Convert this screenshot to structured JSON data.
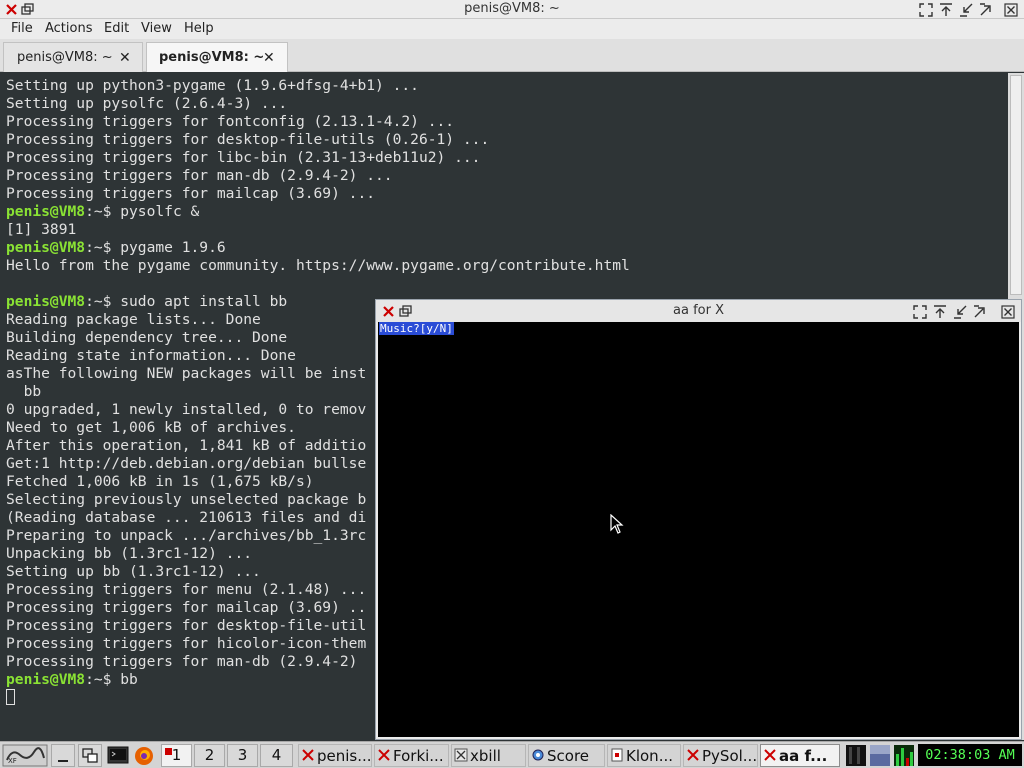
{
  "window": {
    "title": "penis@VM8: ~"
  },
  "menu": [
    "File",
    "Actions",
    "Edit",
    "View",
    "Help"
  ],
  "tabs": [
    {
      "label": "penis@VM8: ~",
      "active": false
    },
    {
      "label": "penis@VM8: ~",
      "active": true
    }
  ],
  "terminal": {
    "lines": [
      {
        "text": "Setting up python3-pygame (1.9.6+dfsg-4+b1) ..."
      },
      {
        "text": "Setting up pysolfc (2.6.4-3) ..."
      },
      {
        "text": "Processing triggers for fontconfig (2.13.1-4.2) ..."
      },
      {
        "text": "Processing triggers for desktop-file-utils (0.26-1) ..."
      },
      {
        "text": "Processing triggers for libc-bin (2.31-13+deb11u2) ..."
      },
      {
        "text": "Processing triggers for man-db (2.9.4-2) ..."
      },
      {
        "text": "Processing triggers for mailcap (3.69) ..."
      },
      {
        "prompt": "penis@VM8",
        "path": ":~$ ",
        "text": "pysolfc &"
      },
      {
        "text": "[1] 3891"
      },
      {
        "prompt": "penis@VM8",
        "path": ":~$ ",
        "text": "pygame 1.9.6"
      },
      {
        "text": "Hello from the pygame community. https://www.pygame.org/contribute.html"
      },
      {
        "text": ""
      },
      {
        "prompt": "penis@VM8",
        "path": ":~$ ",
        "text": "sudo apt install bb"
      },
      {
        "text": "Reading package lists... Done"
      },
      {
        "text": "Building dependency tree... Done"
      },
      {
        "text": "Reading state information... Done"
      },
      {
        "text": "asThe following NEW packages will be inst"
      },
      {
        "text": "  bb"
      },
      {
        "text": "0 upgraded, 1 newly installed, 0 to remov"
      },
      {
        "text": "Need to get 1,006 kB of archives."
      },
      {
        "text": "After this operation, 1,841 kB of additio"
      },
      {
        "text": "Get:1 http://deb.debian.org/debian bullse"
      },
      {
        "text": "Fetched 1,006 kB in 1s (1,675 kB/s)"
      },
      {
        "text": "Selecting previously unselected package b"
      },
      {
        "text": "(Reading database ... 210613 files and di"
      },
      {
        "text": "Preparing to unpack .../archives/bb_1.3rc"
      },
      {
        "text": "Unpacking bb (1.3rc1-12) ..."
      },
      {
        "text": "Setting up bb (1.3rc1-12) ..."
      },
      {
        "text": "Processing triggers for menu (2.1.48) ..."
      },
      {
        "text": "Processing triggers for mailcap (3.69) .."
      },
      {
        "text": "Processing triggers for desktop-file-util"
      },
      {
        "text": "Processing triggers for hicolor-icon-them"
      },
      {
        "text": "Processing triggers for man-db (2.9.4-2) "
      },
      {
        "prompt": "penis@VM8",
        "path": ":~$ ",
        "text": "bb"
      }
    ]
  },
  "aa_window": {
    "title": "aa for X",
    "prompt": "Music?[y/N]"
  },
  "taskbar": {
    "desktops": [
      "1",
      "2",
      "3",
      "4"
    ],
    "tasks": [
      {
        "label": "penis...",
        "icon": "close-x-icon",
        "active": false
      },
      {
        "label": "Forki...",
        "icon": "close-x-icon",
        "active": false
      },
      {
        "label": "xbill",
        "icon": "xbill-icon",
        "active": false
      },
      {
        "label": "Score",
        "icon": "gear-icon",
        "active": false
      },
      {
        "label": "Klon...",
        "icon": "cards-icon",
        "active": false
      },
      {
        "label": "PySol...",
        "icon": "close-x-icon",
        "active": false
      },
      {
        "label": "aa f...",
        "icon": "close-x-icon",
        "active": true
      }
    ],
    "clock": "02:38:03 AM"
  },
  "colors": {
    "terminal_bg": "#2e3436",
    "prompt": "#8ae234",
    "close_red": "#cc0000",
    "clock_fg": "#55ff55"
  }
}
